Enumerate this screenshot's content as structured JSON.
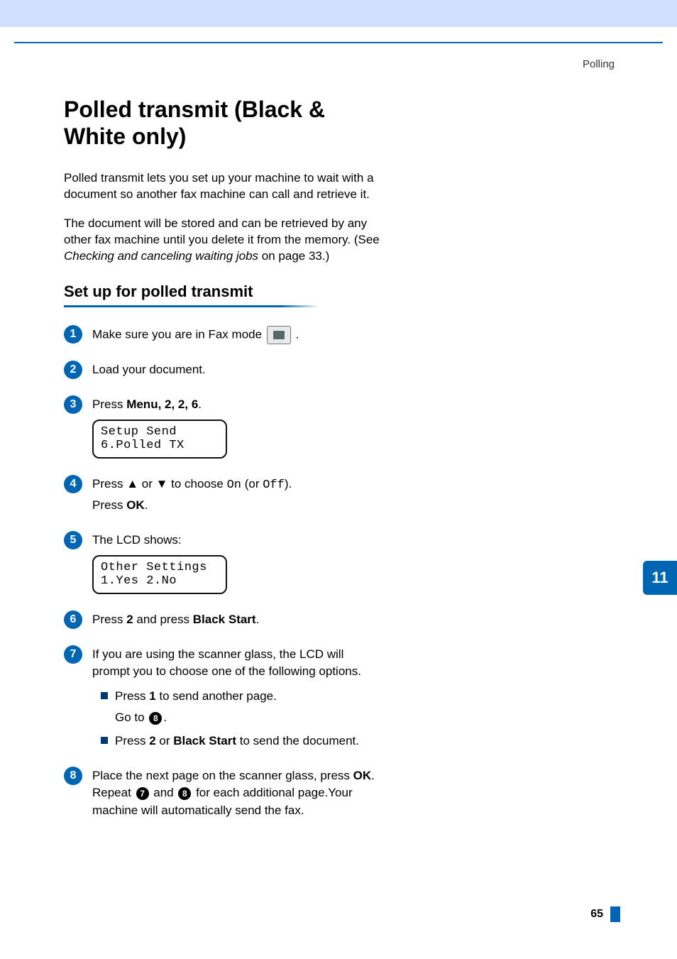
{
  "headerRight": "Polling",
  "title": "Polled transmit (Black & White only)",
  "intro1": "Polled transmit lets you set up your machine to wait with a document so another fax machine can call and retrieve it.",
  "intro2_a": "The document will be stored and can be retrieved by any other fax machine until you delete it from the memory. (See ",
  "intro2_link": "Checking and canceling waiting jobs",
  "intro2_b": " on page 33.)",
  "h2": "Set up for polled transmit",
  "steps": {
    "s1_a": "Make sure you are in Fax mode ",
    "s1_b": ".",
    "s2": "Load your document.",
    "s3_a": "Press ",
    "s3_menu": "Menu",
    "s3_seq": ", 2, 2, 6",
    "s3_period": ".",
    "lcd1_l1": "Setup Send",
    "lcd1_l2": "6.Polled TX",
    "s4_a": "Press ",
    "s4_up": "▲",
    "s4_or": " or ",
    "s4_down": "▼",
    "s4_b": " to choose ",
    "s4_on": "On",
    "s4_c": " (or ",
    "s4_off": "Off",
    "s4_d": ").",
    "s4_e": "Press ",
    "s4_ok": "OK",
    "s4_f": ".",
    "s5": "The LCD shows:",
    "lcd2_l1": "Other Settings",
    "lcd2_l2": "1.Yes 2.No",
    "s6_a": "Press ",
    "s6_2": "2",
    "s6_b": " and press ",
    "s6_bs": "Black Start",
    "s6_c": ".",
    "s7": "If you are using the scanner glass, the LCD will prompt you to choose one of the following options.",
    "s7_sub1_a": "Press ",
    "s7_sub1_1": "1",
    "s7_sub1_b": " to send another page.",
    "s7_sub1_goto_a": "Go to ",
    "s7_sub1_goto_num": "8",
    "s7_sub1_goto_b": ".",
    "s7_sub2_a": "Press ",
    "s7_sub2_2": "2",
    "s7_sub2_b": " or ",
    "s7_sub2_bs": "Black Start",
    "s7_sub2_c": " to send the document.",
    "s8_a": "Place the next page on the scanner glass, press ",
    "s8_ok": "OK",
    "s8_b": ". Repeat ",
    "s8_r1": "7",
    "s8_c": " and ",
    "s8_r2": "8",
    "s8_d": " for each additional page.Your machine will automatically send the fax."
  },
  "sideTab": "11",
  "pageNumber": "65"
}
